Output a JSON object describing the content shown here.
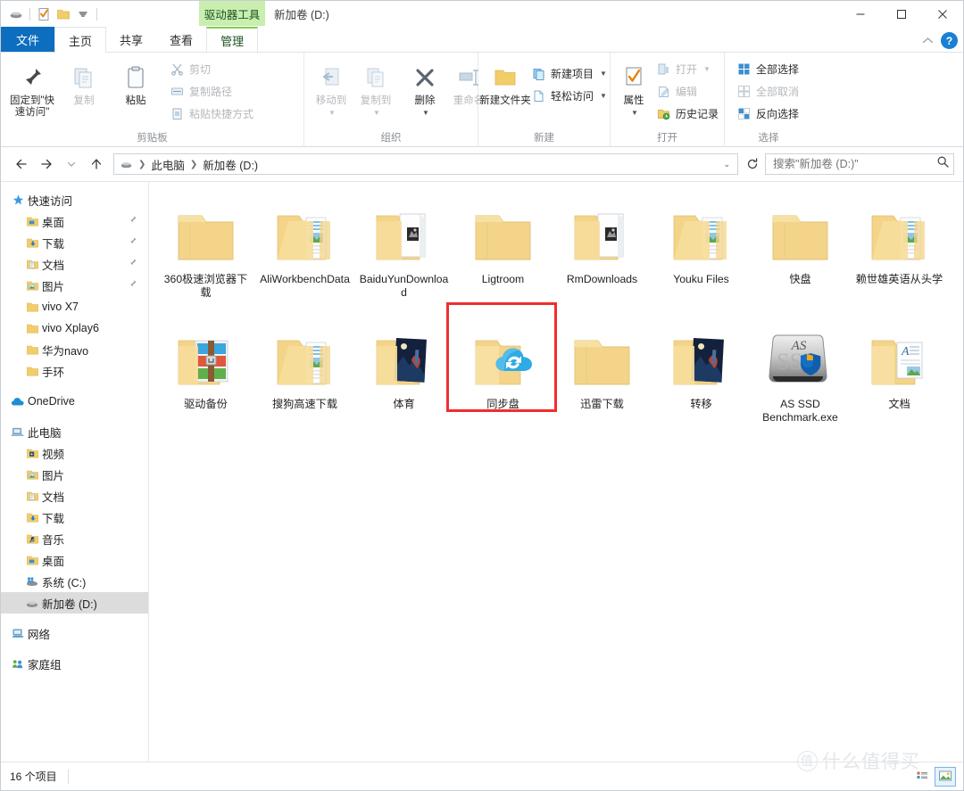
{
  "window": {
    "contextual_tab_header": "驱动器工具",
    "title": "新加卷 (D:)",
    "minimize": "—",
    "maximize": "□",
    "close": "✕"
  },
  "quick_access_toolbar": {
    "items": [
      "drive-icon",
      "properties-icon",
      "new-folder-icon",
      "customize-dropdown-icon"
    ]
  },
  "ribbon": {
    "tabs": [
      {
        "label": "文件",
        "kind": "file"
      },
      {
        "label": "主页",
        "kind": "active"
      },
      {
        "label": "共享",
        "kind": "normal"
      },
      {
        "label": "查看",
        "kind": "normal"
      },
      {
        "label": "管理",
        "kind": "contextual"
      }
    ],
    "collapse_label": "^",
    "help_label": "?",
    "groups": [
      {
        "label": "剪贴板",
        "big_buttons": [
          {
            "label": "固定到\"快速访问\"",
            "icon": "pin-icon",
            "disabled": false
          },
          {
            "label": "复制",
            "icon": "copy-icon",
            "disabled": true
          },
          {
            "label": "粘贴",
            "icon": "paste-icon",
            "disabled": false
          }
        ],
        "small_buttons": [
          {
            "label": "剪切",
            "icon": "scissors-icon",
            "disabled": true
          },
          {
            "label": "复制路径",
            "icon": "copy-path-icon",
            "disabled": true
          },
          {
            "label": "粘贴快捷方式",
            "icon": "paste-shortcut-icon",
            "disabled": true
          }
        ]
      },
      {
        "label": "组织",
        "big_buttons": [
          {
            "label": "移动到",
            "icon": "move-to-icon",
            "disabled": true,
            "caret": true
          },
          {
            "label": "复制到",
            "icon": "copy-to-icon",
            "disabled": true,
            "caret": true
          },
          {
            "label": "删除",
            "icon": "delete-x-icon",
            "disabled": false,
            "caret": true
          },
          {
            "label": "重命名",
            "icon": "rename-icon",
            "disabled": true
          }
        ]
      },
      {
        "label": "新建",
        "big_buttons": [
          {
            "label": "新建文件夹",
            "icon": "new-folder-icon",
            "disabled": false
          }
        ],
        "small_buttons": [
          {
            "label": "新建项目",
            "icon": "new-item-icon",
            "disabled": false,
            "caret": true
          },
          {
            "label": "轻松访问",
            "icon": "easy-access-icon",
            "disabled": false,
            "caret": true
          }
        ]
      },
      {
        "label": "打开",
        "big_buttons": [
          {
            "label": "属性",
            "icon": "properties-icon",
            "disabled": false,
            "caret": true
          }
        ],
        "small_buttons": [
          {
            "label": "打开",
            "icon": "open-icon",
            "disabled": true,
            "caret": true
          },
          {
            "label": "编辑",
            "icon": "edit-icon",
            "disabled": true
          },
          {
            "label": "历史记录",
            "icon": "history-icon",
            "disabled": false
          }
        ]
      },
      {
        "label": "选择",
        "small_buttons": [
          {
            "label": "全部选择",
            "icon": "select-all-icon",
            "disabled": false
          },
          {
            "label": "全部取消",
            "icon": "select-none-icon",
            "disabled": true
          },
          {
            "label": "反向选择",
            "icon": "invert-selection-icon",
            "disabled": false
          }
        ]
      }
    ]
  },
  "address_bar": {
    "back": "←",
    "forward": "→",
    "recent": "⌄",
    "up": "↑",
    "breadcrumbs": [
      "此电脑",
      "新加卷 (D:)"
    ],
    "refresh_icon": "refresh-icon",
    "search_placeholder": "搜索\"新加卷 (D:)\""
  },
  "sidebar": {
    "items": [
      {
        "label": "快速访问",
        "icon": "star-icon",
        "level": 0,
        "pinned": false,
        "selected": false
      },
      {
        "label": "桌面",
        "icon": "desktop-folder-icon",
        "level": 1,
        "pinned": true,
        "selected": false
      },
      {
        "label": "下载",
        "icon": "downloads-folder-icon",
        "level": 1,
        "pinned": true,
        "selected": false
      },
      {
        "label": "文档",
        "icon": "documents-folder-icon",
        "level": 1,
        "pinned": true,
        "selected": false
      },
      {
        "label": "图片",
        "icon": "pictures-folder-icon",
        "level": 1,
        "pinned": true,
        "selected": false
      },
      {
        "label": "vivo X7",
        "icon": "folder-icon",
        "level": 1,
        "pinned": false,
        "selected": false
      },
      {
        "label": "vivo Xplay6",
        "icon": "folder-icon",
        "level": 1,
        "pinned": false,
        "selected": false
      },
      {
        "label": "华为navo",
        "icon": "folder-icon",
        "level": 1,
        "pinned": false,
        "selected": false
      },
      {
        "label": "手环",
        "icon": "folder-icon",
        "level": 1,
        "pinned": false,
        "selected": false
      },
      {
        "gap": true
      },
      {
        "label": "OneDrive",
        "icon": "cloud-icon",
        "level": 0,
        "pinned": false,
        "selected": false
      },
      {
        "gap": true
      },
      {
        "label": "此电脑",
        "icon": "this-pc-icon",
        "level": 0,
        "pinned": false,
        "selected": false
      },
      {
        "label": "视频",
        "icon": "videos-folder-icon",
        "level": 1,
        "pinned": false,
        "selected": false
      },
      {
        "label": "图片",
        "icon": "pictures-folder-icon",
        "level": 1,
        "pinned": false,
        "selected": false
      },
      {
        "label": "文档",
        "icon": "documents-folder-icon",
        "level": 1,
        "pinned": false,
        "selected": false
      },
      {
        "label": "下载",
        "icon": "downloads-folder-icon",
        "level": 1,
        "pinned": false,
        "selected": false
      },
      {
        "label": "音乐",
        "icon": "music-folder-icon",
        "level": 1,
        "pinned": false,
        "selected": false
      },
      {
        "label": "桌面",
        "icon": "desktop-folder-icon",
        "level": 1,
        "pinned": false,
        "selected": false
      },
      {
        "label": "系统 (C:)",
        "icon": "windows-drive-icon",
        "level": 1,
        "pinned": false,
        "selected": false
      },
      {
        "label": "新加卷 (D:)",
        "icon": "drive-icon",
        "level": 1,
        "pinned": false,
        "selected": true
      },
      {
        "gap": true
      },
      {
        "label": "网络",
        "icon": "network-icon",
        "level": 0,
        "pinned": false,
        "selected": false
      },
      {
        "gap": true
      },
      {
        "label": "家庭组",
        "icon": "homegroup-icon",
        "level": 0,
        "pinned": false,
        "selected": false
      }
    ]
  },
  "file_grid": {
    "items": [
      {
        "name": "360极速浏览器下载",
        "icon": "folder-plain-icon"
      },
      {
        "name": "AliWorkbenchData",
        "icon": "folder-with-files-icon"
      },
      {
        "name": "BaiduYunDownload",
        "icon": "folder-open-photo-icon"
      },
      {
        "name": "Ligtroom",
        "icon": "folder-plain-icon"
      },
      {
        "name": "RmDownloads",
        "icon": "folder-open-photo-icon"
      },
      {
        "name": "Youku Files",
        "icon": "folder-with-files-icon"
      },
      {
        "name": "快盘",
        "icon": "folder-plain-icon"
      },
      {
        "name": "赖世雄英语从头学",
        "icon": "folder-with-files-icon"
      },
      {
        "name": "驱动备份",
        "icon": "folder-rar-archive-icon"
      },
      {
        "name": "搜狗高速下载",
        "icon": "folder-with-files-icon"
      },
      {
        "name": "体育",
        "icon": "folder-photo-preview-icon"
      },
      {
        "name": "同步盘",
        "icon": "folder-cloud-sync-icon",
        "highlighted": true
      },
      {
        "name": "迅雷下载",
        "icon": "folder-plain-icon"
      },
      {
        "name": "转移",
        "icon": "folder-photo-preview-icon"
      },
      {
        "name": "AS SSD Benchmark.exe",
        "icon": "as-ssd-benchmark-icon"
      },
      {
        "name": "文档",
        "icon": "folder-document-icon"
      }
    ]
  },
  "status_bar": {
    "item_count": "16 个项目",
    "view_large_icons": "large-icons-view-icon",
    "view_details": "details-view-icon"
  },
  "watermark": {
    "badge": "值",
    "text": "什么值得买"
  },
  "colors": {
    "accent_blue": "#0d6ebf",
    "file_tab_blue": "#0d6ebf",
    "contextual_green": "#c9eeb0",
    "folder_yellow": "#f7d886",
    "highlight_red": "#f22d2d",
    "selection_gray": "#dcdcdc"
  }
}
